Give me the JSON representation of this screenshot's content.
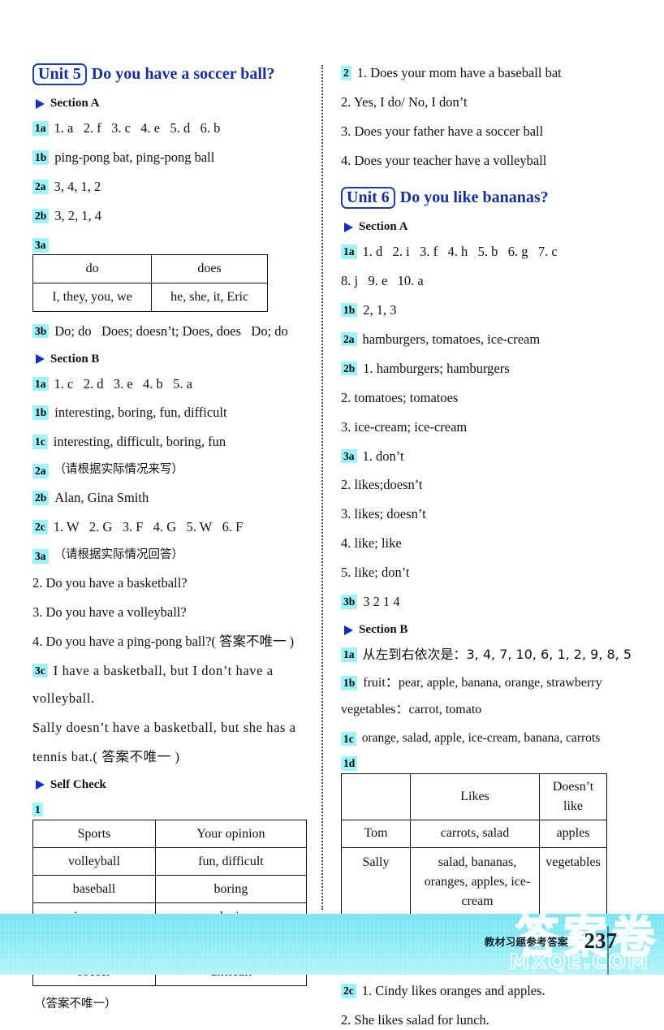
{
  "page": {
    "number": "237",
    "footer_label": "教材习题参考答案",
    "watermark_cn": "答案卷",
    "watermark_site": "MXQE.COM"
  },
  "left_column": {
    "unit": {
      "badge": "Unit 5",
      "title": "Do you have a soccer ball?"
    },
    "section_a": {
      "label": "Section A",
      "items": [
        {
          "tag": "1a",
          "text": "1. a   2. f   3. c   4. e   5. d   6. b"
        },
        {
          "tag": "1b",
          "text": "ping-pong bat, ping-pong ball"
        },
        {
          "tag": "2a",
          "text": "3, 4, 1, 2"
        },
        {
          "tag": "2b",
          "text": "3, 2, 1, 4"
        }
      ],
      "item_3a_tag": "3a",
      "table_3a": {
        "row1": [
          "do",
          "does"
        ],
        "row2": [
          "I, they, you, we",
          "he, she, it, Eric"
        ]
      },
      "item_3b": {
        "tag": "3b",
        "text": "Do; do   Does; doesn’t; Does, does   Do; do"
      }
    },
    "section_b": {
      "label": "Section B",
      "items": [
        {
          "tag": "1a",
          "text": "1. c   2. d   3. e   4. b   5. a"
        },
        {
          "tag": "1b",
          "text": "interesting, boring, fun, difficult"
        },
        {
          "tag": "1c",
          "text": "interesting, difficult, boring, fun"
        },
        {
          "tag": "2a",
          "text": "（请根据实际情况来写）"
        },
        {
          "tag": "2b",
          "text": "Alan, Gina Smith"
        },
        {
          "tag": "2c",
          "text": "1. W   2. G   3. F   4. G   5. W   6. F"
        },
        {
          "tag": "3a",
          "text": "（请根据实际情况回答）"
        }
      ],
      "item_3a_extras": [
        "2. Do you have a basketball?",
        "3. Do you have a volleyball?",
        "4. Do you have a ping-pong ball?( 答案不唯一 )"
      ],
      "item_3c": {
        "tag": "3c",
        "line1": "I have a basketball, but I don’t have a",
        "line2": "volleyball.",
        "line3": "Sally doesn’t have a basketball, but she has a",
        "line4": "tennis bat.( 答案不唯一 )"
      }
    },
    "self_check": {
      "label": "Self Check",
      "tag": "1",
      "table": {
        "headers": [
          "Sports",
          "Your opinion"
        ],
        "rows": [
          [
            "volleyball",
            "fun, difficult"
          ],
          [
            "baseball",
            "boring"
          ],
          [
            "ping-pong",
            "relaxing"
          ],
          [
            "basketball",
            "interesting"
          ],
          [
            "soccer",
            "difficult"
          ]
        ]
      },
      "note": "（答案不唯一）"
    }
  },
  "right_column": {
    "unit5_selfcheck_2": {
      "tag": "2",
      "lines": [
        "1. Does your mom have a baseball bat",
        "2. Yes, I do/ No, I don’t",
        "3. Does your father have a soccer ball",
        "4. Does your teacher have a volleyball"
      ]
    },
    "unit": {
      "badge": "Unit 6",
      "title": "Do you like bananas?"
    },
    "section_a": {
      "label": "Section A",
      "item_1a": {
        "tag": "1a",
        "line1": "1. d   2. i   3. f   4. h   5. b   6. g   7. c",
        "line2": "8. j   9. e   10. a"
      },
      "items": [
        {
          "tag": "1b",
          "text": "2, 1, 3"
        },
        {
          "tag": "2a",
          "text": "hamburgers, tomatoes, ice-cream"
        },
        {
          "tag": "2b",
          "text": "1. hamburgers; hamburgers"
        }
      ],
      "item_2b_extras": [
        "2. tomatoes; tomatoes",
        "3. ice-cream; ice-cream"
      ],
      "item_3a": {
        "tag": "3a",
        "text": "1. don’t"
      },
      "item_3a_extras": [
        "2. likes;doesn’t",
        "3. likes; doesn’t",
        "4. like; like",
        "5. like; don’t"
      ],
      "item_3b": {
        "tag": "3b",
        "text": "3 2 1 4"
      }
    },
    "section_b": {
      "label": "Section B",
      "item_1a": {
        "tag": "1a",
        "text": "从左到右依次是：3, 4, 7, 10, 6, 1, 2, 9, 8, 5"
      },
      "item_1b": {
        "tag": "1b",
        "line1": "fruit：pear, apple, banana, orange, strawberry",
        "line2": "vegetables：carrot, tomato"
      },
      "item_1c": {
        "tag": "1c",
        "text": "orange, salad, apple, ice-cream, banana, carrots"
      },
      "item_1d_tag": "1d",
      "table_1d": {
        "headers": [
          "",
          "Likes",
          "Doesn’t like"
        ],
        "rows": [
          {
            "name": "Tom",
            "likes": "carrots, salad",
            "dislikes": "apples"
          },
          {
            "name": "Sally",
            "likes": "salad, bananas, oranges, apples, ice-cream",
            "dislikes": "vegetables"
          }
        ]
      },
      "item_2b": {
        "tag": "2b",
        "line1": "fruit, bananas, oranges, apples, salad,",
        "line2": "hamburgers, chicken, ice-cream"
      },
      "item_2c": {
        "tag": "2c",
        "line1": "1. Cindy likes oranges and apples.",
        "line2": "2. She likes salad for lunch."
      }
    }
  }
}
